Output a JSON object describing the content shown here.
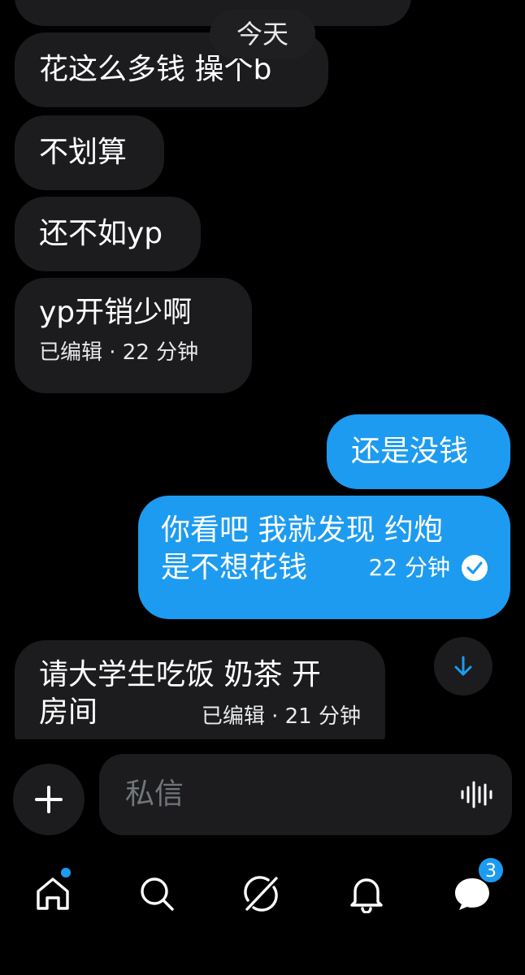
{
  "chat": {
    "date_label": "今天",
    "messages": [
      {
        "text": "花这么多钱 操个b"
      },
      {
        "text": "不划算"
      },
      {
        "text": "还不如yp"
      },
      {
        "text": "yp开销少啊",
        "meta": "已编辑 · 22 分钟"
      },
      {
        "text": "还是没钱"
      },
      {
        "line1": "你看吧 我就发现 约炮",
        "line2": "是不想花钱",
        "time": "22 分钟"
      },
      {
        "line1": "请大学生吃饭 奶茶 开",
        "line2": "房间",
        "meta": "已编辑 · 21 分钟"
      }
    ]
  },
  "composer": {
    "placeholder": "私信"
  },
  "tabbar": {
    "messages_badge": "3"
  },
  "colors": {
    "accent": "#1d9bf0",
    "bubble_in": "#1c1c1e",
    "background": "#000000"
  },
  "icons": [
    "check-circle-icon",
    "arrow-down-icon",
    "plus-icon",
    "waveform-icon",
    "home-icon",
    "search-icon",
    "grok-icon",
    "bell-icon",
    "messages-icon"
  ]
}
